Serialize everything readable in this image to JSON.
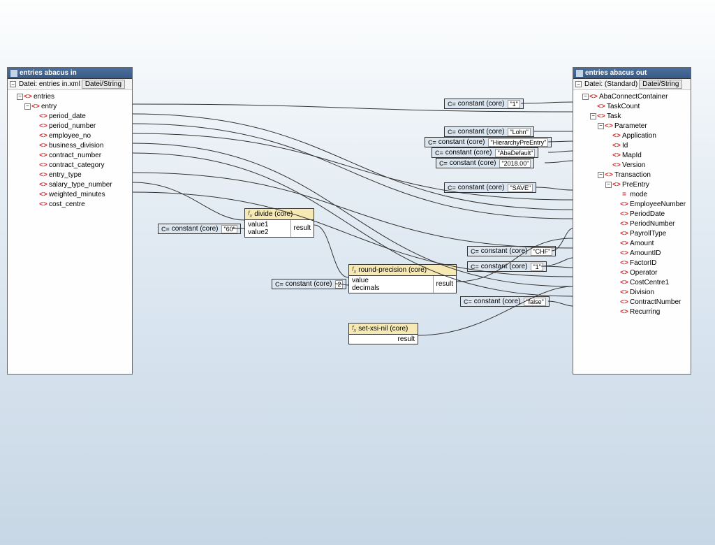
{
  "source": {
    "title": "entries abacus in",
    "file_label": "Datei: entries in.xml",
    "file_button": "Datei/String",
    "root": "entries",
    "entry": "entry",
    "fields": [
      "period_date",
      "period_number",
      "employee_no",
      "business_division",
      "contract_number",
      "contract_category",
      "entry_type",
      "salary_type_number",
      "weighted_minutes",
      "cost_centre"
    ]
  },
  "target": {
    "title": "entries abacus out",
    "file_label": "Datei: (Standard)",
    "file_button": "Datei/String",
    "aba": "AbaConnectContainer",
    "taskcount": "TaskCount",
    "task": "Task",
    "parameter": "Parameter",
    "param_fields": [
      "Application",
      "Id",
      "MapId",
      "Version"
    ],
    "transaction": "Transaction",
    "preentry": "PreEntry",
    "mode": "mode",
    "pre_fields": [
      "EmployeeNumber",
      "PeriodDate",
      "PeriodNumber",
      "PayrollType",
      "Amount",
      "AmountID",
      "FactorID",
      "Operator",
      "CostCentre1",
      "Division",
      "ContractNumber",
      "Recurring"
    ]
  },
  "constants": {
    "c1": {
      "label": "constant (core)",
      "val": "\"1\""
    },
    "lohn": {
      "label": "constant (core)",
      "val": "\"Lohn\""
    },
    "hier": {
      "label": "constant (core)",
      "val": "\"HierarchyPreEntry\""
    },
    "abadef": {
      "label": "constant (core)",
      "val": "\"AbaDefault\""
    },
    "ver": {
      "label": "constant (core)",
      "val": "\"2018.00\""
    },
    "save": {
      "label": "constant (core)",
      "val": "\"SAVE\""
    },
    "sixty": {
      "label": "constant (core)",
      "val": "\"60\""
    },
    "dec2": {
      "label": "constant (core)",
      "val": "2"
    },
    "chf": {
      "label": "constant (core)",
      "val": "\"CHF\""
    },
    "one2": {
      "label": "constant (core)",
      "val": "\"1\""
    },
    "false": {
      "label": "constant (core)",
      "val": "\"false\""
    }
  },
  "functions": {
    "divide": {
      "title": "divide (core)",
      "in": [
        "value1",
        "value2"
      ],
      "out": "result"
    },
    "round": {
      "title": "round-precision (core)",
      "in": [
        "value",
        "decimals"
      ],
      "out": "result"
    },
    "nil": {
      "title": "set-xsi-nil (core)",
      "in": [],
      "out": "result"
    }
  }
}
